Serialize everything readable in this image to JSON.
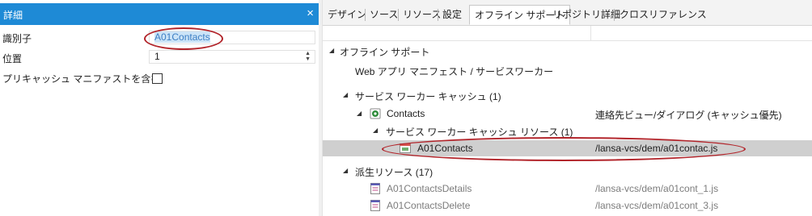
{
  "details": {
    "title": "詳細",
    "close_glyph": "×",
    "properties": [
      {
        "label": "識別子",
        "value": "A01Contacts"
      },
      {
        "label": "位置",
        "value": "1"
      },
      {
        "label": "プリキャッシュ マニファストを含む",
        "checked": false
      }
    ],
    "spinner_up": "▲",
    "spinner_down": "▼"
  },
  "tabs": [
    {
      "label": "デザイン",
      "active": false
    },
    {
      "label": "ソース",
      "active": false
    },
    {
      "label": "リソース",
      "active": false
    },
    {
      "label": "設定",
      "active": false
    },
    {
      "label": "オフライン サポート",
      "active": true
    },
    {
      "label": "リポジトリ詳細",
      "active": false
    },
    {
      "label": "クロスリファレンス",
      "active": false
    }
  ],
  "tree": {
    "root": {
      "label": "オフライン サポート",
      "expander": "◢"
    },
    "manifest": {
      "label": "Web アプリ マニフェスト / サービスワーカー"
    },
    "cache": {
      "label": "サービス ワーカー キャッシュ (1)",
      "expander": "◢"
    },
    "contacts": {
      "label": "Contacts",
      "detail": "連絡先ビュー/ダイアログ (キャッシュ優先)",
      "expander": "◢",
      "icon": "green-gear-icon"
    },
    "cache_resources": {
      "label": "サービス ワーカー キャッシュ リソース (1)",
      "expander": "◢"
    },
    "a01contacts": {
      "label": "A01Contacts",
      "path": "/lansa-vcs/dem/a01contac.js",
      "icon": "web-page-icon",
      "selected": true
    },
    "derived": {
      "label": "派生リソース (17)",
      "expander": "◢"
    },
    "derived_items": [
      {
        "label": "A01ContactsDetails",
        "path": "/lansa-vcs/dem/a01cont_1.js",
        "icon": "form-icon"
      },
      {
        "label": "A01ContactsDelete",
        "path": "/lansa-vcs/dem/a01cont_3.js",
        "icon": "form-icon"
      }
    ]
  },
  "colors": {
    "header_blue": "#1e8ad6",
    "selection_grey": "#cfcfcf",
    "annotation_red": "#b2242a",
    "accent_green": "#2e8b3a"
  }
}
